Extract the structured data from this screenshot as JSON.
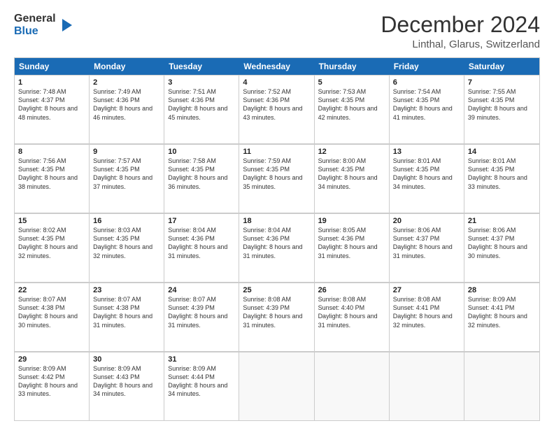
{
  "logo": {
    "line1": "General",
    "line2": "Blue"
  },
  "title": "December 2024",
  "location": "Linthal, Glarus, Switzerland",
  "days_header": [
    "Sunday",
    "Monday",
    "Tuesday",
    "Wednesday",
    "Thursday",
    "Friday",
    "Saturday"
  ],
  "weeks": [
    [
      {
        "day": "1",
        "sunrise": "7:48 AM",
        "sunset": "4:37 PM",
        "daylight": "8 hours and 48 minutes."
      },
      {
        "day": "2",
        "sunrise": "7:49 AM",
        "sunset": "4:36 PM",
        "daylight": "8 hours and 46 minutes."
      },
      {
        "day": "3",
        "sunrise": "7:51 AM",
        "sunset": "4:36 PM",
        "daylight": "8 hours and 45 minutes."
      },
      {
        "day": "4",
        "sunrise": "7:52 AM",
        "sunset": "4:36 PM",
        "daylight": "8 hours and 43 minutes."
      },
      {
        "day": "5",
        "sunrise": "7:53 AM",
        "sunset": "4:35 PM",
        "daylight": "8 hours and 42 minutes."
      },
      {
        "day": "6",
        "sunrise": "7:54 AM",
        "sunset": "4:35 PM",
        "daylight": "8 hours and 41 minutes."
      },
      {
        "day": "7",
        "sunrise": "7:55 AM",
        "sunset": "4:35 PM",
        "daylight": "8 hours and 39 minutes."
      }
    ],
    [
      {
        "day": "8",
        "sunrise": "7:56 AM",
        "sunset": "4:35 PM",
        "daylight": "8 hours and 38 minutes."
      },
      {
        "day": "9",
        "sunrise": "7:57 AM",
        "sunset": "4:35 PM",
        "daylight": "8 hours and 37 minutes."
      },
      {
        "day": "10",
        "sunrise": "7:58 AM",
        "sunset": "4:35 PM",
        "daylight": "8 hours and 36 minutes."
      },
      {
        "day": "11",
        "sunrise": "7:59 AM",
        "sunset": "4:35 PM",
        "daylight": "8 hours and 35 minutes."
      },
      {
        "day": "12",
        "sunrise": "8:00 AM",
        "sunset": "4:35 PM",
        "daylight": "8 hours and 34 minutes."
      },
      {
        "day": "13",
        "sunrise": "8:01 AM",
        "sunset": "4:35 PM",
        "daylight": "8 hours and 34 minutes."
      },
      {
        "day": "14",
        "sunrise": "8:01 AM",
        "sunset": "4:35 PM",
        "daylight": "8 hours and 33 minutes."
      }
    ],
    [
      {
        "day": "15",
        "sunrise": "8:02 AM",
        "sunset": "4:35 PM",
        "daylight": "8 hours and 32 minutes."
      },
      {
        "day": "16",
        "sunrise": "8:03 AM",
        "sunset": "4:35 PM",
        "daylight": "8 hours and 32 minutes."
      },
      {
        "day": "17",
        "sunrise": "8:04 AM",
        "sunset": "4:36 PM",
        "daylight": "8 hours and 31 minutes."
      },
      {
        "day": "18",
        "sunrise": "8:04 AM",
        "sunset": "4:36 PM",
        "daylight": "8 hours and 31 minutes."
      },
      {
        "day": "19",
        "sunrise": "8:05 AM",
        "sunset": "4:36 PM",
        "daylight": "8 hours and 31 minutes."
      },
      {
        "day": "20",
        "sunrise": "8:06 AM",
        "sunset": "4:37 PM",
        "daylight": "8 hours and 31 minutes."
      },
      {
        "day": "21",
        "sunrise": "8:06 AM",
        "sunset": "4:37 PM",
        "daylight": "8 hours and 30 minutes."
      }
    ],
    [
      {
        "day": "22",
        "sunrise": "8:07 AM",
        "sunset": "4:38 PM",
        "daylight": "8 hours and 30 minutes."
      },
      {
        "day": "23",
        "sunrise": "8:07 AM",
        "sunset": "4:38 PM",
        "daylight": "8 hours and 31 minutes."
      },
      {
        "day": "24",
        "sunrise": "8:07 AM",
        "sunset": "4:39 PM",
        "daylight": "8 hours and 31 minutes."
      },
      {
        "day": "25",
        "sunrise": "8:08 AM",
        "sunset": "4:39 PM",
        "daylight": "8 hours and 31 minutes."
      },
      {
        "day": "26",
        "sunrise": "8:08 AM",
        "sunset": "4:40 PM",
        "daylight": "8 hours and 31 minutes."
      },
      {
        "day": "27",
        "sunrise": "8:08 AM",
        "sunset": "4:41 PM",
        "daylight": "8 hours and 32 minutes."
      },
      {
        "day": "28",
        "sunrise": "8:09 AM",
        "sunset": "4:41 PM",
        "daylight": "8 hours and 32 minutes."
      }
    ],
    [
      {
        "day": "29",
        "sunrise": "8:09 AM",
        "sunset": "4:42 PM",
        "daylight": "8 hours and 33 minutes."
      },
      {
        "day": "30",
        "sunrise": "8:09 AM",
        "sunset": "4:43 PM",
        "daylight": "8 hours and 34 minutes."
      },
      {
        "day": "31",
        "sunrise": "8:09 AM",
        "sunset": "4:44 PM",
        "daylight": "8 hours and 34 minutes."
      },
      null,
      null,
      null,
      null
    ]
  ],
  "labels": {
    "sunrise": "Sunrise:",
    "sunset": "Sunset:",
    "daylight": "Daylight:"
  }
}
